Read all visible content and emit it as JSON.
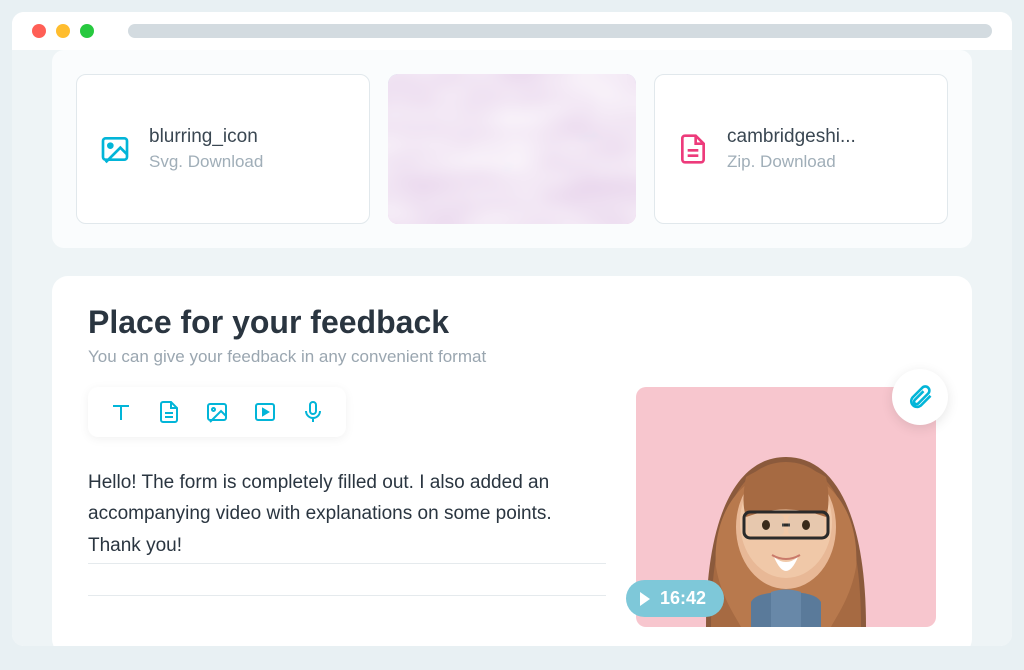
{
  "files": [
    {
      "name": "blurring_icon",
      "meta": "Svg. Download",
      "icon": "image-icon",
      "icon_color": "#02b5d8"
    },
    {
      "name": "cambridgeshi...",
      "meta": "Zip. Download",
      "icon": "document-icon",
      "icon_color": "#ed3b7b"
    }
  ],
  "feedback": {
    "title": "Place for your feedback",
    "subtitle": "You can give your feedback in any convenient format",
    "message": "Hello! The form is completely filled out. I also added an accompanying video with explanations on some points. Thank you!"
  },
  "video": {
    "duration": "16:42"
  },
  "colors": {
    "accent": "#02b5d8",
    "pink": "#ed3b7b",
    "badge": "#7ec8d9"
  }
}
